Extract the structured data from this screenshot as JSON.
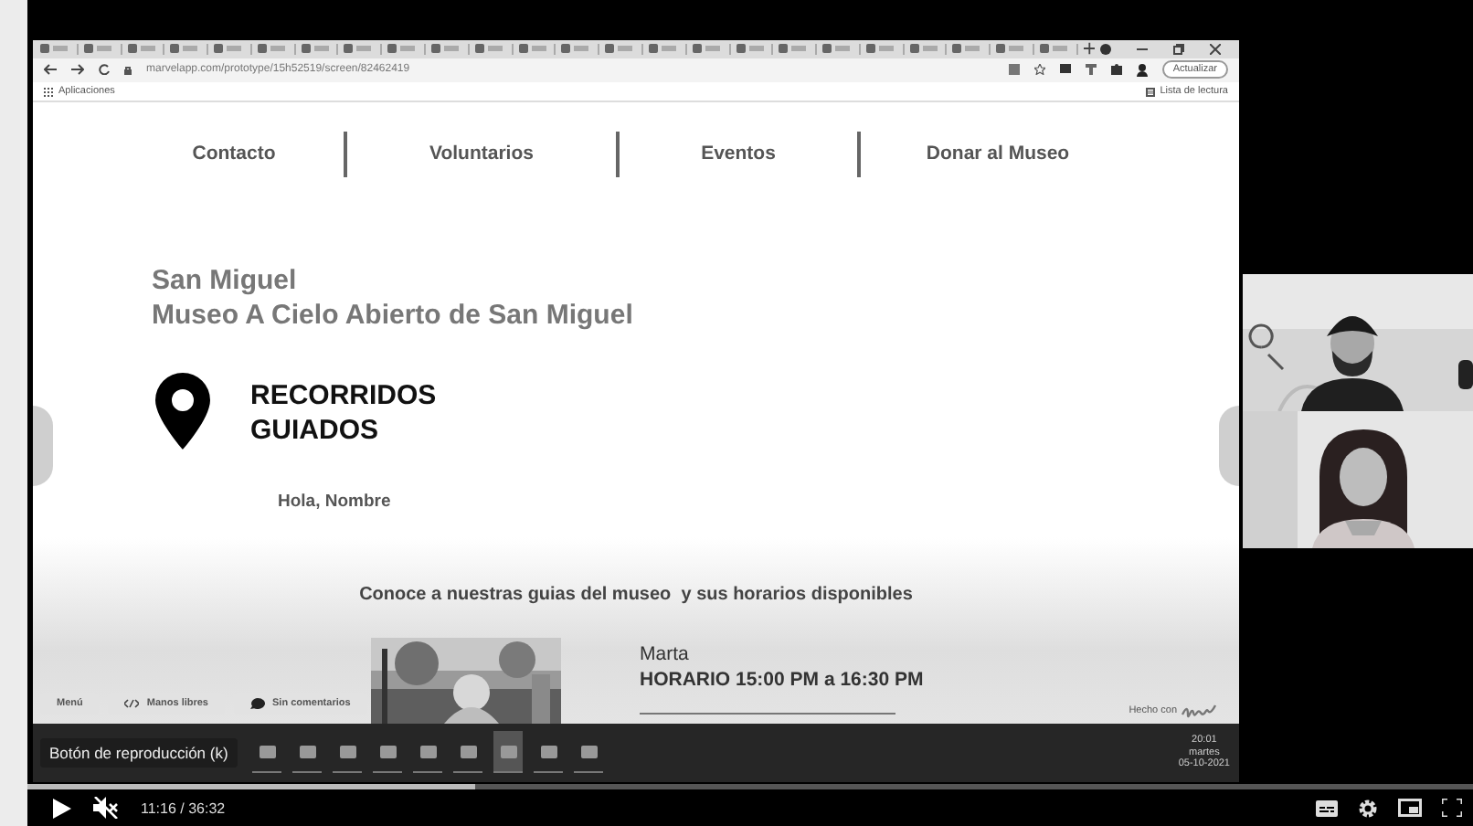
{
  "browser": {
    "url": "marvelapp.com/prototype/15h52519/screen/82462419",
    "update_button": "Actualizar",
    "bookmarks": [
      "Aplicaciones"
    ],
    "reading_list": "Lista de lectura"
  },
  "page": {
    "nav": [
      "Contacto",
      "Voluntarios",
      "Eventos",
      "Donar al Museo"
    ],
    "location": "San Miguel",
    "museum": "Museo A Cielo Abierto de San Miguel",
    "section_title": "RECORRIDOS GUIADOS",
    "greeting": "Hola, Nombre",
    "intro": "Conoce a nuestras guias del museo  y sus horarios disponibles",
    "guides": [
      {
        "name": "Marta",
        "schedule": "HORARIO 15:00 PM a 16:30 PM"
      }
    ],
    "footer_buttons": [
      {
        "kind": "plain",
        "label": "Menú"
      },
      {
        "kind": "code",
        "label": "Manos libres"
      },
      {
        "kind": "comment",
        "label": "Sin comentarios"
      }
    ],
    "made_with": "Hecho con"
  },
  "taskbar": {
    "clock": [
      "20:01",
      "martes",
      "05-10-2021"
    ]
  },
  "player": {
    "tooltip": "Botón de reproducción (k)",
    "progress": {
      "level": 0.31
    },
    "muted": true,
    "time": "11:16 / 36:32"
  }
}
